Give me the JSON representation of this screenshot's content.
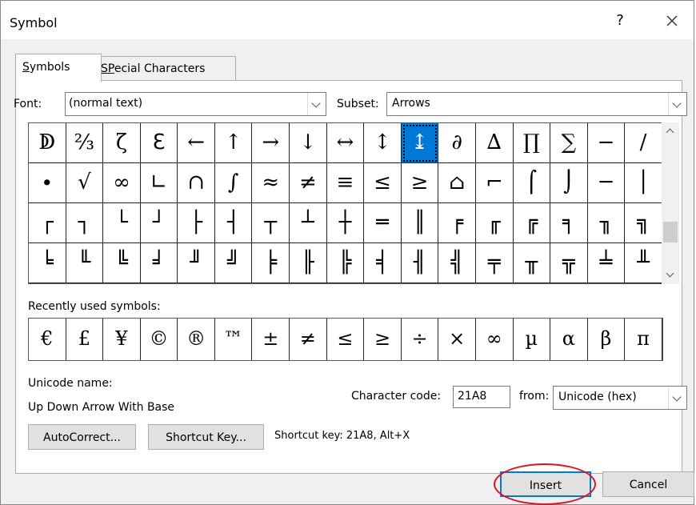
{
  "window": {
    "title": "Symbol",
    "help_label": "?"
  },
  "tabs": [
    {
      "label": "Symbols",
      "accesskey": "S",
      "rest": "ymbols"
    },
    {
      "label": "Special Characters",
      "accesskey": "P",
      "before": "S",
      "rest": "ecial Characters"
    }
  ],
  "font": {
    "label": "Font:",
    "value": "(normal text)"
  },
  "subset": {
    "label": "Subset:",
    "value": "Arrows"
  },
  "symbol_grid": {
    "rows": [
      [
        "ↁ",
        "⅔",
        "ζ",
        "ℇ",
        "←",
        "↑",
        "→",
        "↓",
        "↔",
        "↕",
        "↨",
        "∂",
        "∆",
        "∏",
        "∑",
        "−",
        "∕"
      ],
      [
        "∙",
        "√",
        "∞",
        "∟",
        "∩",
        "∫",
        "≈",
        "≠",
        "≡",
        "≤",
        "≥",
        "⌂",
        "⌐",
        "⌠",
        "⌡",
        "─",
        "│"
      ],
      [
        "┌",
        "┐",
        "└",
        "┘",
        "├",
        "┤",
        "┬",
        "┴",
        "┼",
        "═",
        "║",
        "╒",
        "╓",
        "╔",
        "╕",
        "╖",
        "╗"
      ],
      [
        "╘",
        "╙",
        "╚",
        "╛",
        "╜",
        "╝",
        "╞",
        "╟",
        "╠",
        "╡",
        "╢",
        "╣",
        "╤",
        "╥",
        "╦",
        "╧",
        "╨"
      ]
    ],
    "selected": {
      "row": 0,
      "col": 10
    }
  },
  "recent": {
    "label": "Recently used symbols:",
    "symbols": [
      "€",
      "£",
      "¥",
      "©",
      "®",
      "™",
      "±",
      "≠",
      "≤",
      "≥",
      "÷",
      "×",
      "∞",
      "µ",
      "α",
      "β",
      "π"
    ]
  },
  "unicode_name": {
    "label": "Unicode name:",
    "value": "Up Down Arrow With Base"
  },
  "character_code": {
    "label": "Character code:",
    "value": "21A8"
  },
  "from": {
    "label": "from:",
    "value": "Unicode (hex)"
  },
  "buttons": {
    "autocorrect": "AutoCorrect...",
    "shortcut_key": "Shortcut Key...",
    "insert": "Insert",
    "cancel": "Cancel"
  },
  "shortcut_text": "Shortcut key: 21A8, Alt+X",
  "colors": {
    "selection": "#0078d7",
    "highlight_ring": "#e0141e"
  }
}
